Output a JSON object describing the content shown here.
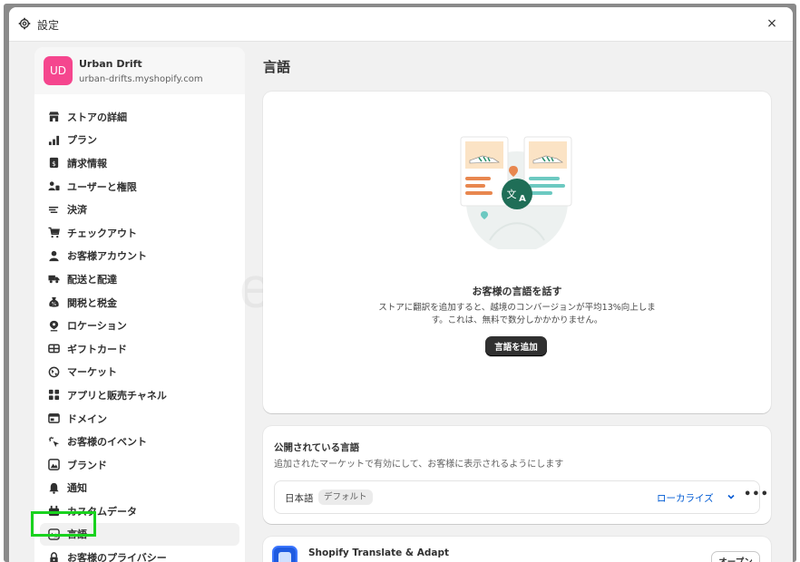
{
  "window": {
    "title": "設定",
    "close_glyph": "×"
  },
  "store": {
    "avatar_initials": "UD",
    "avatar_color": "#f5468e",
    "name": "Urban Drift",
    "domain": "urban-drifts.myshopify.com"
  },
  "sidebar": {
    "items": [
      {
        "label": "ストアの詳細",
        "icon": "store-icon"
      },
      {
        "label": "プラン",
        "icon": "plan-icon"
      },
      {
        "label": "請求情報",
        "icon": "billing-icon"
      },
      {
        "label": "ユーザーと権限",
        "icon": "users-icon"
      },
      {
        "label": "決済",
        "icon": "payments-icon"
      },
      {
        "label": "チェックアウト",
        "icon": "cart-icon"
      },
      {
        "label": "お客様アカウント",
        "icon": "person-icon"
      },
      {
        "label": "配送と配達",
        "icon": "truck-icon"
      },
      {
        "label": "関税と税金",
        "icon": "tax-icon"
      },
      {
        "label": "ロケーション",
        "icon": "location-icon"
      },
      {
        "label": "ギフトカード",
        "icon": "gift-card-icon"
      },
      {
        "label": "マーケット",
        "icon": "globe-icon"
      },
      {
        "label": "アプリと販売チャネル",
        "icon": "apps-icon"
      },
      {
        "label": "ドメイン",
        "icon": "domain-icon"
      },
      {
        "label": "お客様のイベント",
        "icon": "cursor-icon"
      },
      {
        "label": "ブランド",
        "icon": "brand-icon"
      },
      {
        "label": "通知",
        "icon": "bell-icon"
      },
      {
        "label": "カスタムデータ",
        "icon": "database-icon"
      },
      {
        "label": "言語",
        "icon": "language-icon",
        "active": true
      },
      {
        "label": "お客様のプライバシー",
        "icon": "lock-icon"
      }
    ]
  },
  "main": {
    "title": "言語",
    "hero": {
      "heading": "お客様の言語を話す",
      "body": "ストアに翻訳を追加すると、越境のコンバージョンが平均13%向上します。これは、無料で数分しかかかりません。",
      "button": "言語を追加"
    },
    "published": {
      "heading": "公開されている言語",
      "subheading": "追加されたマーケットで有効にして、お客様に表示されるようにします",
      "language": "日本語",
      "badge": "デフォルト",
      "localize": "ローカライズ",
      "more": "•••"
    },
    "app": {
      "name": "Shopify Translate & Adapt",
      "button": "オープン"
    }
  },
  "watermark": "ec-abc.com",
  "colors": {
    "accent_link": "#005bd3",
    "primary_button": "#303030",
    "highlight_box": "#19d21e"
  }
}
